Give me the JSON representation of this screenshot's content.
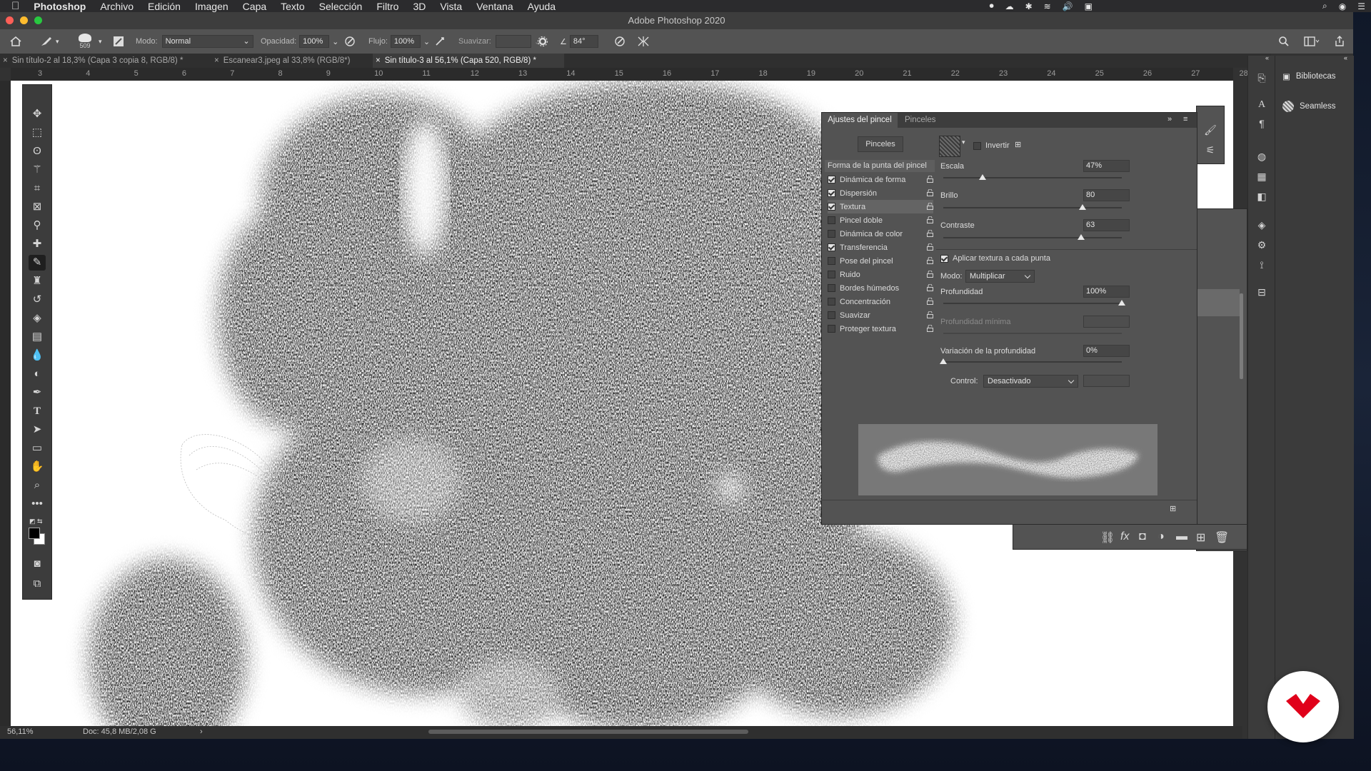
{
  "menubar": {
    "app": "Photoshop",
    "items": [
      "Archivo",
      "Edición",
      "Imagen",
      "Capa",
      "Texto",
      "Selección",
      "Filtro",
      "3D",
      "Vista",
      "Ventana",
      "Ayuda"
    ]
  },
  "window": {
    "title": "Adobe Photoshop 2020"
  },
  "options": {
    "brush_size": "509",
    "mode_label": "Modo:",
    "mode_value": "Normal",
    "opacity_label": "Opacidad:",
    "opacity_value": "100%",
    "flow_label": "Flujo:",
    "flow_value": "100%",
    "smooth_label": "Suavizar:",
    "angle_value": "84°"
  },
  "tabs": [
    {
      "label": "Sin título-2 al 18,3% (Capa 3 copia 8, RGB/8) *"
    },
    {
      "label": "Escanear3.jpeg al 33,8% (RGB/8*)"
    },
    {
      "label": "Sin título-3 al 56,1% (Capa 520, RGB/8) *"
    }
  ],
  "ruler": [
    "3",
    "4",
    "5",
    "6",
    "7",
    "8",
    "9",
    "10",
    "11",
    "12",
    "13",
    "14",
    "15",
    "16",
    "17",
    "18",
    "19",
    "20",
    "21",
    "22",
    "23",
    "24",
    "25",
    "26",
    "27",
    "28"
  ],
  "status": {
    "zoom": "56,11%",
    "doc": "Doc: 45,8 MB/2,08 G"
  },
  "brush_panel": {
    "tab_active": "Ajustes del pincel",
    "tab_other": "Pinceles",
    "brushes_button": "Pinceles",
    "tip_shape": "Forma de la punta del pincel",
    "options": [
      {
        "label": "Dinámica de forma",
        "checked": true
      },
      {
        "label": "Dispersión",
        "checked": true
      },
      {
        "label": "Textura",
        "checked": true
      },
      {
        "label": "Pincel doble",
        "checked": false
      },
      {
        "label": "Dinámica de color",
        "checked": false
      },
      {
        "label": "Transferencia",
        "checked": true
      },
      {
        "label": "Pose del pincel",
        "checked": false
      },
      {
        "label": "Ruido",
        "checked": false
      },
      {
        "label": "Bordes húmedos",
        "checked": false
      },
      {
        "label": "Concentración",
        "checked": false
      },
      {
        "label": "Suavizar",
        "checked": false
      },
      {
        "label": "Proteger textura",
        "checked": false
      }
    ],
    "invert_label": "Invertir",
    "scale": {
      "label": "Escala",
      "value": "47%",
      "fraction": 0.22
    },
    "brightness": {
      "label": "Brillo",
      "value": "80",
      "fraction": 0.78
    },
    "contrast": {
      "label": "Contraste",
      "value": "63",
      "fraction": 0.77
    },
    "apply_each": "Aplicar textura a cada punta",
    "mode_label": "Modo:",
    "mode_value": "Multiplicar",
    "depth": {
      "label": "Profundidad",
      "value": "100%",
      "fraction": 1.0
    },
    "min_depth": {
      "label": "Profundidad mínima"
    },
    "depth_jitter": {
      "label": "Variación de la profundidad",
      "value": "0%",
      "fraction": 0.0
    },
    "control_label": "Control:",
    "control_value": "Desactivado"
  },
  "dock": {
    "libraries": "Bibliotecas",
    "seamless": "Seamless"
  }
}
